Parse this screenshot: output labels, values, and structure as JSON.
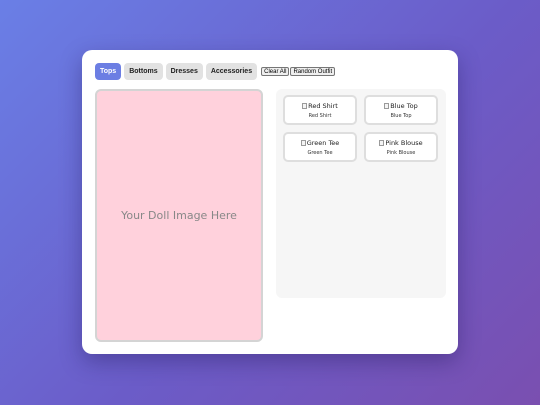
{
  "toolbar": {
    "tabs": [
      {
        "label": "Tops",
        "active": true
      },
      {
        "label": "Bottoms",
        "active": false
      },
      {
        "label": "Dresses",
        "active": false
      },
      {
        "label": "Accessories",
        "active": false
      }
    ],
    "clear_label": "Clear All",
    "random_label": "Random Outfit"
  },
  "doll": {
    "placeholder": "Your Doll Image Here"
  },
  "clothes": {
    "items": [
      {
        "alt": "Red Shirt",
        "name": "Red Shirt"
      },
      {
        "alt": "Blue Top",
        "name": "Blue Top"
      },
      {
        "alt": "Green Tee",
        "name": "Green Tee"
      },
      {
        "alt": "Pink Blouse",
        "name": "Pink Blouse"
      }
    ]
  },
  "colors": {
    "accent": "#6c7ee3",
    "doll_bg": "#ffd1dc",
    "page_gradient": [
      "#6a7fe6",
      "#7a4fb0"
    ]
  },
  "icons": {
    "broken_image": "broken-image-icon"
  }
}
